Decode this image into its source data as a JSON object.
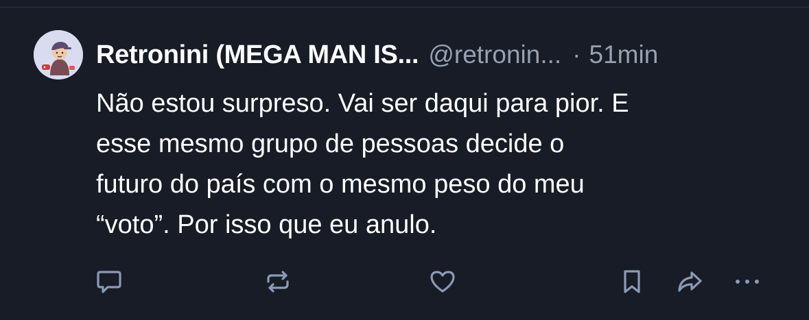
{
  "post": {
    "author": {
      "display_name": "Retronini (MEGA MAN IS...",
      "handle": "@retronin...",
      "avatar": "avatar-illustration"
    },
    "separator": "·",
    "time": "51min",
    "text_lines": [
      "Não estou surpreso. Vai ser daqui para pior. E",
      "esse mesmo grupo de pessoas decide o",
      "futuro do país com o mesmo peso do meu",
      "“voto”. Por isso que eu anulo."
    ]
  },
  "actions": [
    {
      "name": "reply",
      "icon": "speech-bubble-icon"
    },
    {
      "name": "repost",
      "icon": "repost-arrows-icon"
    },
    {
      "name": "like",
      "icon": "heart-icon"
    },
    {
      "name": "bookmark",
      "icon": "bookmark-icon"
    },
    {
      "name": "share",
      "icon": "share-arrow-icon"
    },
    {
      "name": "more",
      "icon": "ellipsis-icon"
    }
  ],
  "colors": {
    "background": "#171c26",
    "text": "#ffffff",
    "muted": "#98a1b1",
    "icon": "#8c9ab7"
  }
}
